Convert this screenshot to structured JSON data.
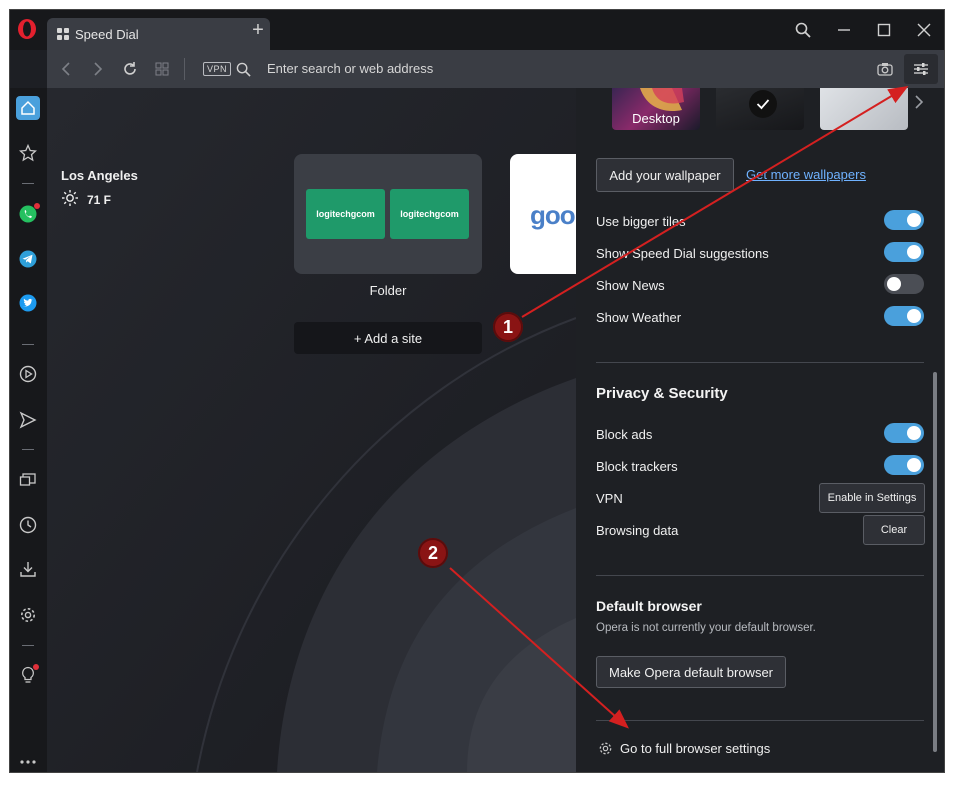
{
  "tab": {
    "title": "Speed Dial",
    "icon": "speed-dial-grid-icon"
  },
  "address_bar": {
    "vpn_badge": "VPN",
    "placeholder": "Enter search or web address"
  },
  "sidebar": {
    "icons": [
      "home-icon",
      "bookmark-star-icon",
      "whatsapp-icon",
      "telegram-icon",
      "twitter-icon",
      "player-icon",
      "send-icon",
      "tabs-icon",
      "history-clock-icon",
      "downloads-icon",
      "settings-gear-icon",
      "lightbulb-icon",
      "more-dots-icon"
    ]
  },
  "weather": {
    "city": "Los Angeles",
    "temperature": "71 F"
  },
  "speed_dial": {
    "folder_tile_1": "logitechgcom",
    "folder_tile_2": "logitechgcom",
    "folder_label": "Folder",
    "google_tile_text": "goo",
    "add_site_label": "+ Add a site"
  },
  "easy_setup": {
    "wallpaper_selected_label": "Desktop",
    "add_wallpaper_label": "Add your wallpaper",
    "get_wallpapers_link": "Get more wallpapers",
    "toggles": {
      "bigger_tiles": {
        "label": "Use bigger tiles",
        "on": true
      },
      "suggestions": {
        "label": "Show Speed Dial suggestions",
        "on": true
      },
      "news": {
        "label": "Show News",
        "on": false
      },
      "weather": {
        "label": "Show Weather",
        "on": true
      }
    },
    "privacy": {
      "title": "Privacy & Security",
      "block_ads": {
        "label": "Block ads",
        "on": true
      },
      "block_trackers": {
        "label": "Block trackers",
        "on": true
      },
      "vpn_label": "VPN",
      "vpn_button": "Enable in Settings",
      "browsing_data_label": "Browsing data",
      "clear_button": "Clear"
    },
    "default_browser": {
      "title": "Default browser",
      "description": "Opera is not currently your default browser.",
      "button": "Make Opera default browser"
    },
    "full_settings_link": "Go to full browser settings"
  },
  "annotations": {
    "badge_1": "1",
    "badge_2": "2",
    "arrow_color": "#d42020"
  },
  "colors": {
    "accent_toggle": "#4aa0dc",
    "badge": "#8a1414",
    "link": "#6fb2ff"
  }
}
